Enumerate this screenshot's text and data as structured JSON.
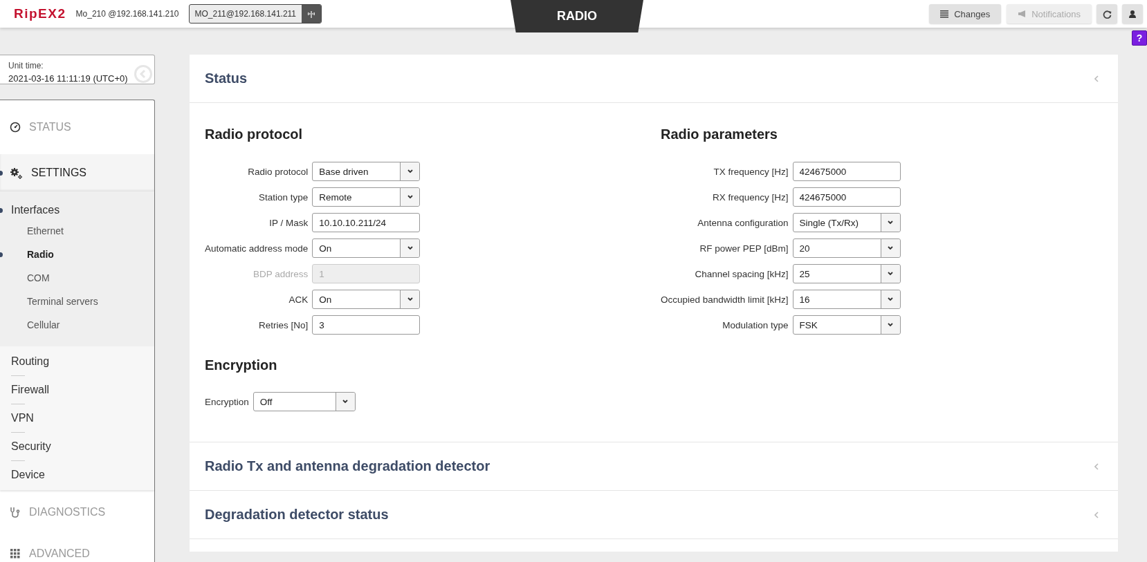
{
  "top_bar": {
    "logo": "RipEX2",
    "local_unit": "Mo_210 @192.168.141.210",
    "remote_unit": "MO_211@192.168.141.211",
    "page_title": "RADIO",
    "buttons": [
      {
        "kind": "changes",
        "label": "Changes",
        "disabled": false
      },
      {
        "kind": "notifications",
        "label": "Notifications",
        "disabled": true
      }
    ]
  },
  "sidebar": {
    "unit_time_label": "Unit time:",
    "unit_time": "2021-03-16 11:11:19 (UTC+0)",
    "sections": [
      {
        "kind": "status",
        "label": "STATUS",
        "selected": false
      },
      {
        "kind": "settings",
        "label": "SETTINGS",
        "selected": true,
        "children": [
          {
            "label": "Interfaces",
            "selected": true,
            "children": [
              {
                "label": "Ethernet",
                "selected": false
              },
              {
                "label": "Radio",
                "selected": true
              },
              {
                "label": "COM",
                "selected": false
              },
              {
                "label": "Terminal servers",
                "selected": false
              },
              {
                "label": "Cellular",
                "selected": false
              }
            ]
          },
          {
            "label": "Routing",
            "selected": false
          },
          {
            "label": "Firewall",
            "selected": false
          },
          {
            "label": "VPN",
            "selected": false
          },
          {
            "label": "Security",
            "selected": false
          },
          {
            "label": "Device",
            "selected": false
          }
        ]
      },
      {
        "kind": "diagnostics",
        "label": "DIAGNOSTICS",
        "selected": false
      },
      {
        "kind": "advanced",
        "label": "ADVANCED",
        "selected": false
      }
    ]
  },
  "help_button": "?",
  "panels": [
    {
      "title": "Status",
      "groups": [
        {
          "title": "Radio protocol",
          "kind": "aligned",
          "fields": [
            {
              "label": "Radio protocol",
              "kind": "select",
              "value": "Base driven",
              "disabled": false
            },
            {
              "label": "Station type",
              "kind": "select",
              "value": "Remote",
              "disabled": false
            },
            {
              "label": "IP / Mask",
              "kind": "text",
              "value": "10.10.10.211/24",
              "disabled": false
            },
            {
              "label": "Automatic address mode",
              "kind": "select",
              "value": "On",
              "disabled": false
            },
            {
              "label": "BDP address",
              "kind": "text",
              "value": "1",
              "disabled": true
            },
            {
              "label": "ACK",
              "kind": "select",
              "value": "On",
              "disabled": false
            },
            {
              "label": "Retries [No]",
              "kind": "text",
              "value": "3",
              "disabled": false
            }
          ]
        },
        {
          "title": "Radio parameters",
          "kind": "aligned",
          "fields": [
            {
              "label": "TX frequency [Hz]",
              "kind": "text",
              "value": "424675000",
              "disabled": false
            },
            {
              "label": "RX frequency [Hz]",
              "kind": "text",
              "value": "424675000",
              "disabled": false
            },
            {
              "label": "Antenna configuration",
              "kind": "select",
              "value": "Single (Tx/Rx)",
              "disabled": false
            },
            {
              "label": "RF power PEP [dBm]",
              "kind": "select",
              "value": "20",
              "disabled": false
            },
            {
              "label": "Channel spacing [kHz]",
              "kind": "select",
              "value": "25",
              "disabled": false
            },
            {
              "label": "Occupied bandwidth limit [kHz]",
              "kind": "select",
              "value": "16",
              "disabled": false
            },
            {
              "label": "Modulation type",
              "kind": "select",
              "value": "FSK",
              "disabled": false
            }
          ]
        },
        {
          "title": "Encryption",
          "kind": "inline",
          "fields": [
            {
              "label": "Encryption",
              "kind": "select",
              "value": "Off",
              "disabled": false
            }
          ]
        }
      ]
    },
    {
      "title": "Radio Tx and antenna degradation detector"
    },
    {
      "title": "Degradation detector status"
    }
  ]
}
